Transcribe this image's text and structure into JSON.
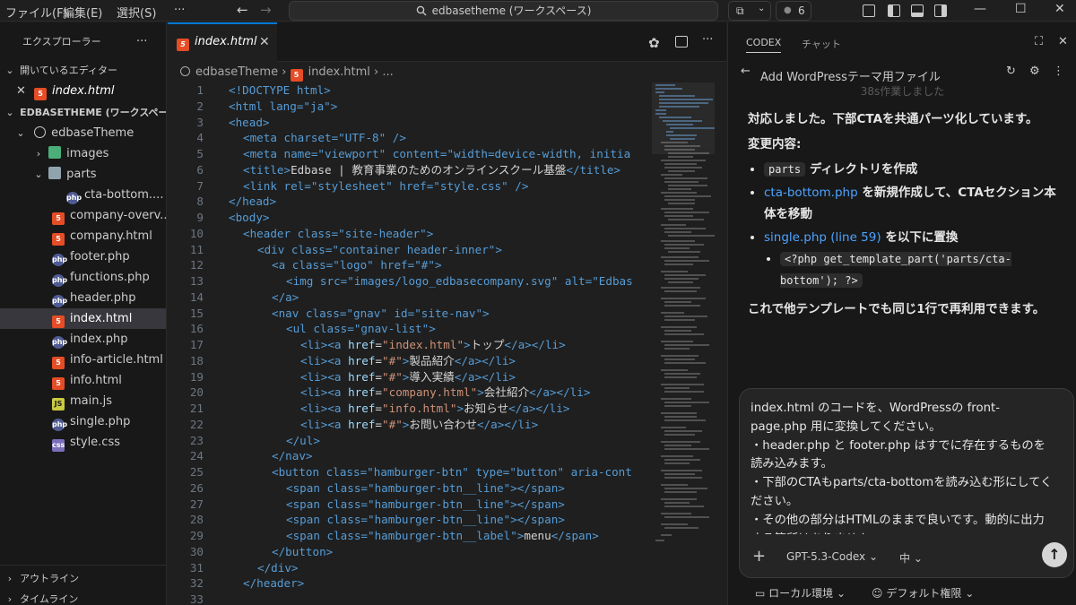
{
  "menu": {
    "file": "ファイル(F)",
    "edit": "編集(E)",
    "select": "選択(S)",
    "more": "···"
  },
  "command_center": {
    "text": "edbasetheme (ワークスペース)"
  },
  "titlebar": {
    "badge_count": "6"
  },
  "explorer": {
    "title": "エクスプローラー",
    "more": "···",
    "open_editors_label": "開いているエディター",
    "open_editor_file": "index.html",
    "workspace_label": "EDBASETHEME (ワークスペース)",
    "root_folder": "edbaseTheme",
    "items": [
      {
        "name": "images",
        "kind": "folder-img"
      },
      {
        "name": "parts",
        "kind": "folder"
      },
      {
        "name": "cta-bottom....",
        "kind": "php"
      },
      {
        "name": "company-overv...",
        "kind": "html"
      },
      {
        "name": "company.html",
        "kind": "html"
      },
      {
        "name": "footer.php",
        "kind": "php"
      },
      {
        "name": "functions.php",
        "kind": "php"
      },
      {
        "name": "header.php",
        "kind": "php"
      },
      {
        "name": "index.html",
        "kind": "html"
      },
      {
        "name": "index.php",
        "kind": "php"
      },
      {
        "name": "info-article.html",
        "kind": "html"
      },
      {
        "name": "info.html",
        "kind": "html"
      },
      {
        "name": "main.js",
        "kind": "js"
      },
      {
        "name": "single.php",
        "kind": "php"
      },
      {
        "name": "style.css",
        "kind": "css"
      }
    ],
    "outline_label": "アウトライン",
    "timeline_label": "タイムライン"
  },
  "editor": {
    "tab_label": "index.html",
    "breadcrumb": {
      "root": "edbaseTheme",
      "file": "index.html",
      "more": "..."
    },
    "line_numbers": [
      "1",
      "2",
      "3",
      "4",
      "5",
      "6",
      "7",
      "8",
      "9",
      "10",
      "11",
      "12",
      "13",
      "14",
      "15",
      "16",
      "17",
      "18",
      "19",
      "20",
      "21",
      "22",
      "23",
      "24",
      "25",
      "26",
      "27",
      "28",
      "29",
      "30",
      "31",
      "32",
      "33"
    ],
    "code": {
      "l1": "<!DOCTYPE html>",
      "l2": "<html lang=\"ja\">",
      "l3": "<head>",
      "l4": "<meta charset=\"UTF-8\" />",
      "l5": "<meta name=\"viewport\" content=\"width=device-width, initia",
      "l6_a": "<title>",
      "l6_b": "Edbase | 教育事業のためのオンラインスクール基盤",
      "l6_c": "</title>",
      "l7": "<link rel=\"stylesheet\" href=\"style.css\" />",
      "l8": "</head>",
      "l9": "<body>",
      "l10": "<header class=\"site-header\">",
      "l11": "<div class=\"container header-inner\">",
      "l12": "<a class=\"logo\" href=\"#\">",
      "l13": "<img src=\"images/logo_edbasecompany.svg\" alt=\"Edbas",
      "l14": "</a>",
      "l15": "<nav class=\"gnav\" id=\"site-nav\">",
      "l16": "<ul class=\"gnav-list\">",
      "l17_href": "index.html",
      "l17_text": "トップ",
      "l18_href": "#",
      "l18_text": "製品紹介",
      "l19_href": "#",
      "l19_text": "導入実績",
      "l20_href": "company.html",
      "l20_text": "会社紹介",
      "l21_href": "info.html",
      "l21_text": "お知らせ",
      "l22_href": "#",
      "l22_text": "お問い合わせ",
      "l23": "</ul>",
      "l24": "</nav>",
      "l25": "<button class=\"hamburger-btn\" type=\"button\" aria-cont",
      "l26": "<span class=\"hamburger-btn__line\"></span>",
      "l27": "<span class=\"hamburger-btn__line\"></span>",
      "l28": "<span class=\"hamburger-btn__line\"></span>",
      "l29_a": "<span class=\"hamburger-btn__label\">",
      "l29_b": "menu",
      "l29_c": "</span>",
      "l30": "</button>",
      "l31": "</div>",
      "l32": "</header>",
      "l33": ""
    }
  },
  "codex": {
    "tab_codex": "CODEX",
    "tab_chat": "チャット",
    "thread_title": "Add WordPressテーマ用ファイル",
    "faded_line": "38s作業しました",
    "message_intro": "対応しました。下部CTAを共通パーツ化しています。",
    "changes_heading": "変更内容:",
    "bullet1_chip": "parts",
    "bullet1_text": " ディレクトリを作成",
    "bullet2_link": "cta-bottom.php",
    "bullet2_text": " を新規作成して、CTAセクション本体を移動",
    "bullet3_link": "single.php (line 59)",
    "bullet3_text": " を以下に置換",
    "bullet3_code": "<?php get_template_part('parts/cta-bottom'); ?>",
    "message_outro": "これで他テンプレートでも同じ1行で再利用できます。",
    "input_text": "index.html のコードを、WordPressの front-page.php 用に変換してください。\n・header.php と footer.php はすでに存在するものを読み込みます。\n・下部のCTAもparts/cta-bottomを読み込む形にしてください。\n・その他の部分はHTMLのままで良いです。動的に出力する箇所はありません",
    "model": "GPT-5.3-Codex",
    "effort": "中",
    "env": "ローカル環境",
    "permission": "デフォルト権限"
  }
}
